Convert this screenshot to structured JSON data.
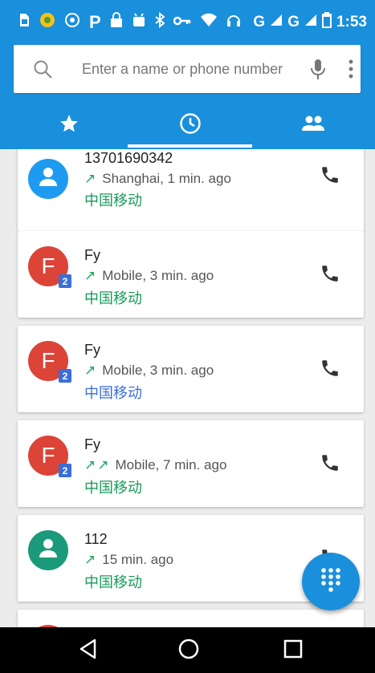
{
  "status_bar": {
    "icons": [
      "sim-card-icon",
      "app-notification-icon",
      "sync-icon",
      "parking-icon",
      "lock-icon",
      "android-icon",
      "bluetooth-icon",
      "key-icon",
      "wifi-icon",
      "headset-icon"
    ],
    "network_1": "G",
    "network_2": "G",
    "time": "1:53"
  },
  "search": {
    "placeholder": "Enter a name or phone number"
  },
  "tabs": [
    {
      "name": "favorites",
      "icon": "star-icon",
      "active": false
    },
    {
      "name": "recents",
      "icon": "clock-icon",
      "active": true
    },
    {
      "name": "contacts",
      "icon": "people-icon",
      "active": false
    }
  ],
  "call_log": [
    {
      "name": "13701690342",
      "direction": "↗",
      "detail": "Shanghai, 1 min. ago",
      "carrier": "中国移动",
      "carrier_color": "#1a9a5a",
      "avatar": "person",
      "avatar_color": "#1e9bf0",
      "sim": ""
    },
    {
      "name": "Fy",
      "direction": "↗",
      "detail": "Mobile, 3 min. ago",
      "carrier": "中国移动",
      "carrier_color": "#1a9a5a",
      "avatar": "F",
      "avatar_color": "#db4437",
      "sim": "2"
    },
    {
      "name": "Fy",
      "direction": "↗",
      "detail": "Mobile, 3 min. ago",
      "carrier": "中国移动",
      "carrier_color": "#3a6fd8",
      "avatar": "F",
      "avatar_color": "#db4437",
      "sim": "2"
    },
    {
      "name": "Fy",
      "direction": "↗↗",
      "detail": "Mobile, 7 min. ago",
      "carrier": "中国移动",
      "carrier_color": "#1a9a5a",
      "avatar": "F",
      "avatar_color": "#db4437",
      "sim": "2"
    },
    {
      "name": "112",
      "direction": "↗",
      "detail": "15 min. ago",
      "carrier": "中国移动",
      "carrier_color": "#1a9a5a",
      "avatar": "person",
      "avatar_color": "#1a9a7a",
      "sim": ""
    }
  ],
  "colors": {
    "accent": "#1a8fdc",
    "outgoing_arrow": "#1aa85c"
  },
  "fab": {
    "icon": "dialpad-icon"
  },
  "nav": [
    "back-icon",
    "home-icon",
    "recents-icon"
  ]
}
